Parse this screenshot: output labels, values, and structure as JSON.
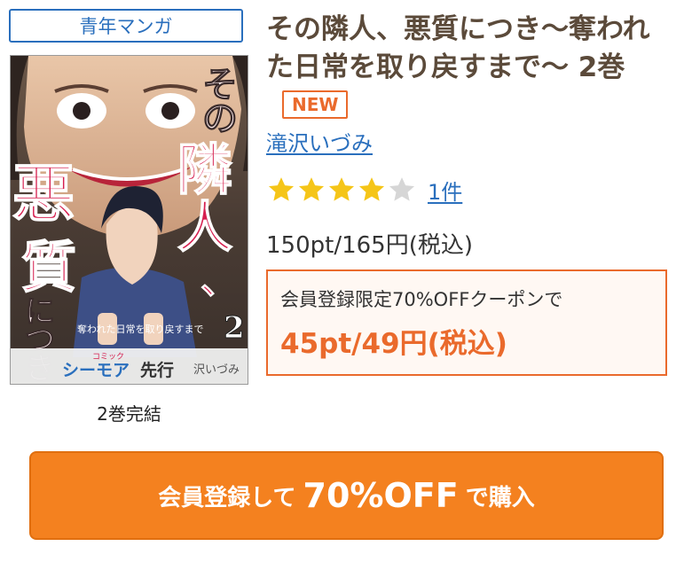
{
  "genre": "青年マンガ",
  "title": "その隣人、悪質につき〜奪われた日常を取り戻すまで〜 2巻",
  "new_badge": "NEW",
  "author": "滝沢いづみ",
  "rating": {
    "value": 4,
    "max": 5,
    "count_label": "1件",
    "star_color": "#f5c518",
    "empty_color": "#d6d6d6"
  },
  "price": "150pt/165円(税込)",
  "coupon": {
    "label": "会員登録限定70%OFFクーポンで",
    "price": "45pt/49円(税込)"
  },
  "volume_status": "2巻完結",
  "cover": {
    "title_chars": [
      "その",
      "隣",
      "人、",
      "悪",
      "質",
      "につき"
    ],
    "subtitle": "奪われた日常を取り戻すまで",
    "volume_number": "2",
    "label_brand": "シーモア",
    "label_small": "コミック",
    "label_first": "先行",
    "author_fragment": "沢いづみ"
  },
  "buy_button": {
    "prefix": "会員登録して",
    "highlight": "70%OFF",
    "suffix": "で購入"
  },
  "colors": {
    "accent": "#ea6a2c",
    "link": "#2a6fbd",
    "button": "#f4811f",
    "title": "#5b4a3a"
  }
}
